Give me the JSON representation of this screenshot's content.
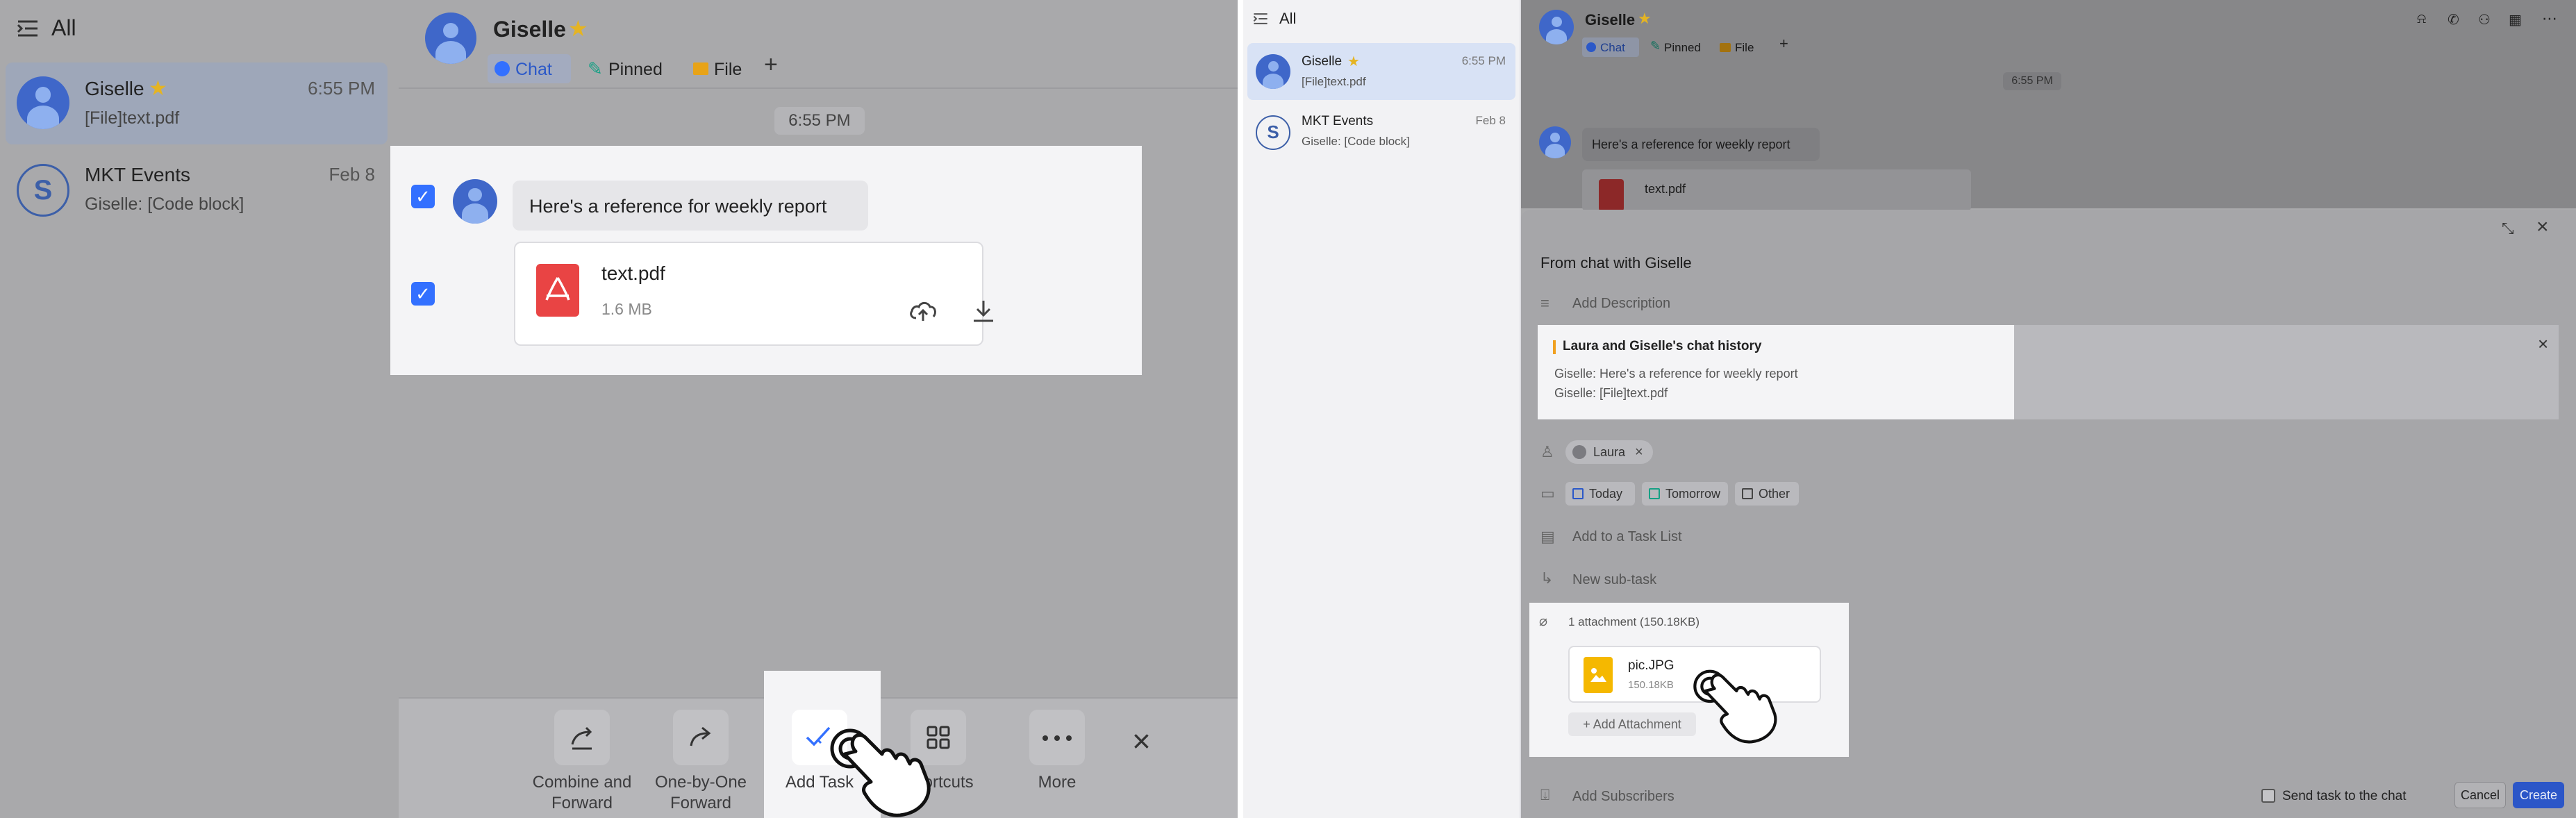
{
  "left": {
    "sidebar": {
      "title": "All",
      "chats": [
        {
          "name": "Giselle",
          "time": "6:55 PM",
          "preview": "[File]text.pdf"
        },
        {
          "name": "MKT Events",
          "time": "Feb 8",
          "preview": "Giselle: [Code block]",
          "initial": "S"
        }
      ]
    },
    "header": {
      "name": "Giselle",
      "tabs": [
        {
          "label": "Chat"
        },
        {
          "label": "Pinned"
        },
        {
          "label": "File"
        }
      ],
      "add_tab": "+"
    },
    "timestamp": "6:55 PM",
    "message": {
      "text": "Here's a reference for weekly report",
      "file": {
        "name": "text.pdf",
        "size": "1.6 MB"
      }
    },
    "toolbar": {
      "items": [
        {
          "label1": "Combine and",
          "label2": "Forward"
        },
        {
          "label1": "One-by-One",
          "label2": "Forward"
        },
        {
          "label1": "Add Task",
          "label2": ""
        },
        {
          "label1": "Shortcuts",
          "label2": ""
        },
        {
          "label1": "More",
          "label2": ""
        }
      ],
      "close": "×"
    }
  },
  "right": {
    "sidebar": {
      "title": "All",
      "chats": [
        {
          "name": "Giselle",
          "time": "6:55 PM",
          "preview": "[File]text.pdf"
        },
        {
          "name": "MKT Events",
          "time": "Feb 8",
          "preview": "Giselle: [Code block]",
          "initial": "S"
        }
      ]
    },
    "header": {
      "name": "Giselle",
      "tabs": [
        {
          "label": "Chat"
        },
        {
          "label": "Pinned"
        },
        {
          "label": "File"
        }
      ],
      "add_tab": "+"
    },
    "timestamp": "6:55 PM",
    "message": {
      "text": "Here's a reference for weekly report",
      "file": {
        "name": "text.pdf"
      }
    },
    "task": {
      "source": "From chat with Giselle",
      "description_placeholder": "Add Description",
      "history": {
        "title": "Laura and Giselle's chat history",
        "line1": "Giselle: Here's a reference for weekly report",
        "line2": "Giselle: [File]text.pdf"
      },
      "assignee": "Laura",
      "due": {
        "today": "Today",
        "tomorrow": "Tomorrow",
        "other": "Other"
      },
      "task_list": "Add to a Task List",
      "subtask": "New sub-task",
      "attachments": {
        "count": "1 attachment (150.18KB)",
        "file_name": "pic.JPG",
        "file_size": "150.18KB",
        "add": "+ Add Attachment"
      },
      "subscribers": "Add Subscribers",
      "send_to_chat": "Send task to the chat",
      "cancel": "Cancel",
      "create": "Create"
    }
  },
  "colors": {
    "accent": "#3370ff",
    "pdf_red": "#e94444",
    "image_yellow": "#f5b800",
    "pinned_green": "#16a085",
    "star": "#e5b422"
  }
}
